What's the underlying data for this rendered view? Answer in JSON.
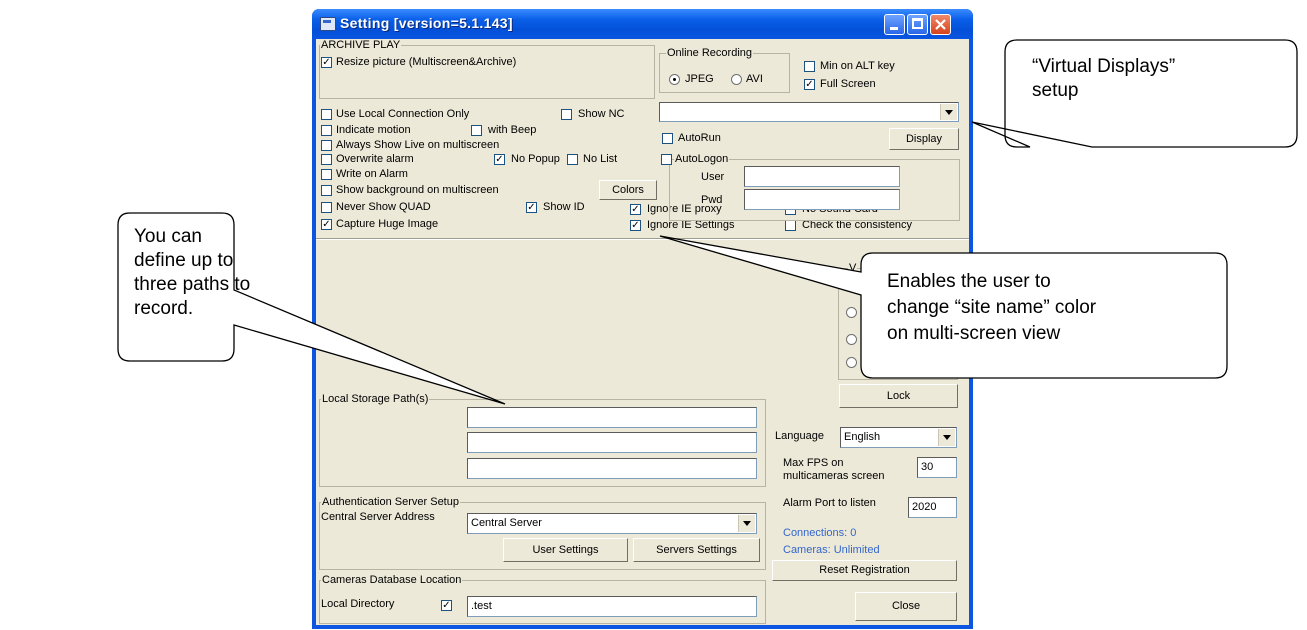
{
  "window": {
    "title": "Setting [version=5.1.143]"
  },
  "archive_play": {
    "group_label": "ARCHIVE PLAY",
    "resize_picture": "Resize picture (Multiscreen&Archive)"
  },
  "online_recording": {
    "group_label": "Online Recording",
    "jpeg": "JPEG",
    "avi": "AVI",
    "min_on_alt": "Min on ALT key",
    "full_screen": "Full Screen"
  },
  "options": {
    "use_local_connection": "Use Local Connection Only",
    "show_nc": "Show NC",
    "indicate_motion": "Indicate motion",
    "with_beep": "with Beep",
    "always_show_live": "Always Show Live on multiscreen",
    "overwrite_alarm": "Overwrite alarm",
    "no_popup": "No Popup",
    "no_list": "No List",
    "write_on_alarm": "Write on Alarm",
    "show_background": "Show background on multiscreen",
    "colors_button": "Colors",
    "never_show_quad": "Never Show QUAD",
    "show_id": "Show ID",
    "capture_huge_image": "Capture Huge Image",
    "ignore_ie_proxy": "Ignore IE proxy",
    "ignore_ie_settings": "Ignore IE Settings",
    "no_sound_card": "No Sound Card",
    "check_consistency": "Check the consistency"
  },
  "display": {
    "autorun": "AutoRun",
    "autologon": "AutoLogon",
    "user_label": "User",
    "pwd_label": "Pwd",
    "display_button": "Display"
  },
  "video_group_label": "V",
  "lock_button": "Lock",
  "local_storage": {
    "group_label": "Local Storage Path(s)"
  },
  "language": {
    "label": "Language",
    "value": "English"
  },
  "max_fps": {
    "label_line1": "Max FPS on",
    "label_line2": "multicameras screen",
    "value": "30"
  },
  "alarm_port": {
    "label": "Alarm Port to listen",
    "value": "2020"
  },
  "status": {
    "connections": "Connections: 0",
    "cameras": "Cameras: Unlimited"
  },
  "reset_registration": "Reset Registration",
  "close": "Close",
  "auth": {
    "group_label": "Authentication Server Setup",
    "central_label": "Central Server Address",
    "central_value": "Central Server",
    "user_settings": "User Settings",
    "servers_settings": "Servers Settings"
  },
  "cameras_db": {
    "group_label": "Cameras Database Location",
    "local_dir_label": "Local Directory",
    "path_value": ".test"
  },
  "callouts": {
    "virtual_displays_1": "“Virtual Displays”",
    "virtual_displays_2": "setup",
    "paths_1": "You can",
    "paths_2": "define up to",
    "paths_3": "three paths to",
    "paths_4": "record.",
    "color_1": "Enables the user to",
    "color_2": "change “site name” color",
    "color_3": "on multi-screen view"
  },
  "colors": {
    "titlebar": "#0a5fe8",
    "dialog_bg": "#ece9d8",
    "status_text": "#3366cc"
  }
}
